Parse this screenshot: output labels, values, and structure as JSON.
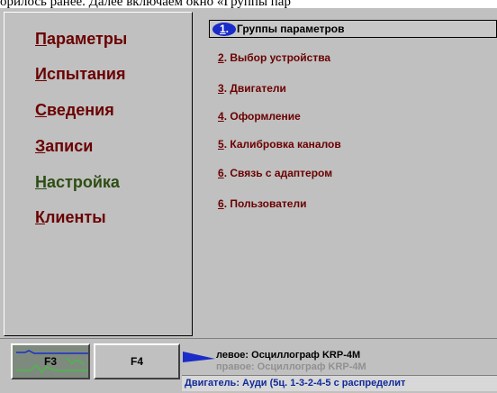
{
  "top_caption": "орилось ранее. Далее включаем окно «Группы пар",
  "left_menu": [
    {
      "first": "П",
      "rest": "араметры"
    },
    {
      "first": "И",
      "rest": "спытания"
    },
    {
      "first": "С",
      "rest": "ведения"
    },
    {
      "first": "З",
      "rest": "аписи"
    },
    {
      "first": "Н",
      "rest": "астройка"
    },
    {
      "first": "К",
      "rest": "лиенты"
    }
  ],
  "right_menu": {
    "selected": {
      "num": "1",
      "dot": ".",
      "label": "Группы параметров"
    },
    "items": [
      {
        "num": "2",
        "rest": ". Выбор устройства"
      },
      {
        "num": "3",
        "rest": ". Двигатели"
      },
      {
        "num": "4",
        "rest": ". Оформление"
      },
      {
        "num": "5",
        "rest": ". Калибровка каналов"
      },
      {
        "num": "6",
        "rest": ". Связь с адаптером"
      },
      {
        "num": "6",
        "rest": ". Пользователи"
      }
    ]
  },
  "fkeys": {
    "f3": "F3",
    "f4": "F4"
  },
  "channels": {
    "left": "левое:  Осциллограф KRP-4M",
    "right": "правое:  Осциллограф KRP-4M"
  },
  "engine_line": "Двигатель: Ауди (5ц. 1-3-2-4-5 с распределит",
  "colors": {
    "menu_text": "#6b0000",
    "accent_green": "#2e4d12",
    "selection_blue": "#1a2cc8",
    "engine_text": "#102a9a"
  }
}
